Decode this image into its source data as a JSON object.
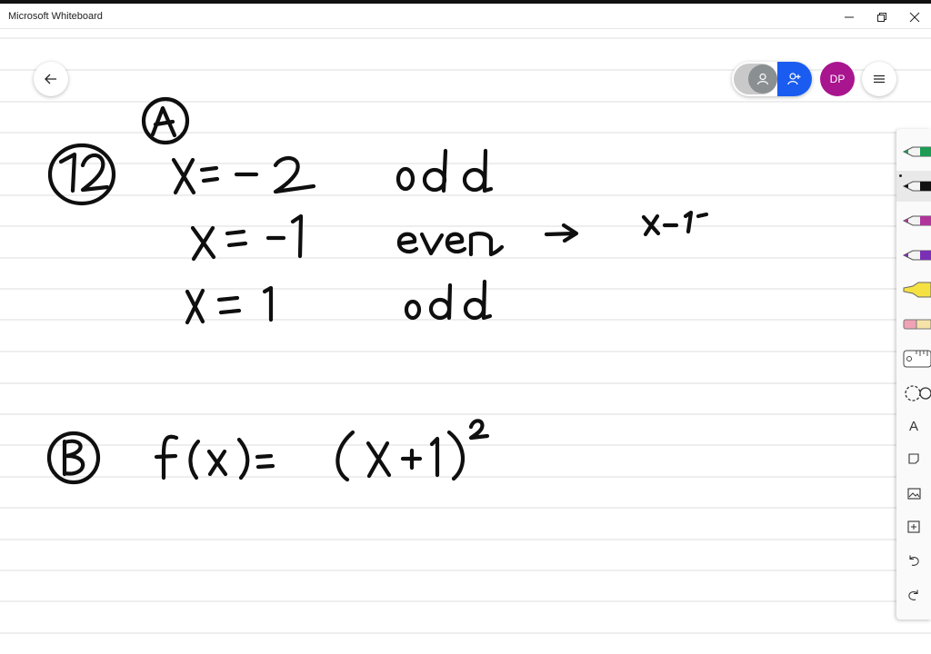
{
  "window": {
    "title": "Microsoft Whiteboard",
    "minimize_icon": "minimize-icon",
    "maximize_icon": "restore-icon",
    "close_icon": "close-icon"
  },
  "header": {
    "back_icon": "back-arrow-icon",
    "user_initials": "DP",
    "menu_icon": "hamburger-menu-icon"
  },
  "colors": {
    "line": "#dcdcdc",
    "ink": "#0f0f0f",
    "invite_blue": "#1a5cf0",
    "avatar_magenta": "#a9148f",
    "green_pen": "#1e9b55",
    "black_pen": "#111111",
    "pink_pen": "#b0359a",
    "purple_pen": "#7a2fb5",
    "highlighter": "#f5e142",
    "eraser": "#f1a3b5"
  },
  "tools": [
    {
      "name": "green-pen",
      "selected": false
    },
    {
      "name": "black-pen",
      "selected": true
    },
    {
      "name": "pink-pen",
      "selected": false
    },
    {
      "name": "purple-pen",
      "selected": false
    },
    {
      "name": "highlighter",
      "selected": false
    },
    {
      "name": "eraser",
      "selected": false
    },
    {
      "name": "ruler",
      "selected": false
    },
    {
      "name": "lasso",
      "selected": false
    },
    {
      "name": "text",
      "glyph": "A",
      "selected": false
    },
    {
      "name": "note",
      "selected": false
    },
    {
      "name": "image",
      "selected": false
    },
    {
      "name": "insert",
      "selected": false
    },
    {
      "name": "undo",
      "selected": false
    },
    {
      "name": "redo",
      "selected": false
    }
  ]
}
